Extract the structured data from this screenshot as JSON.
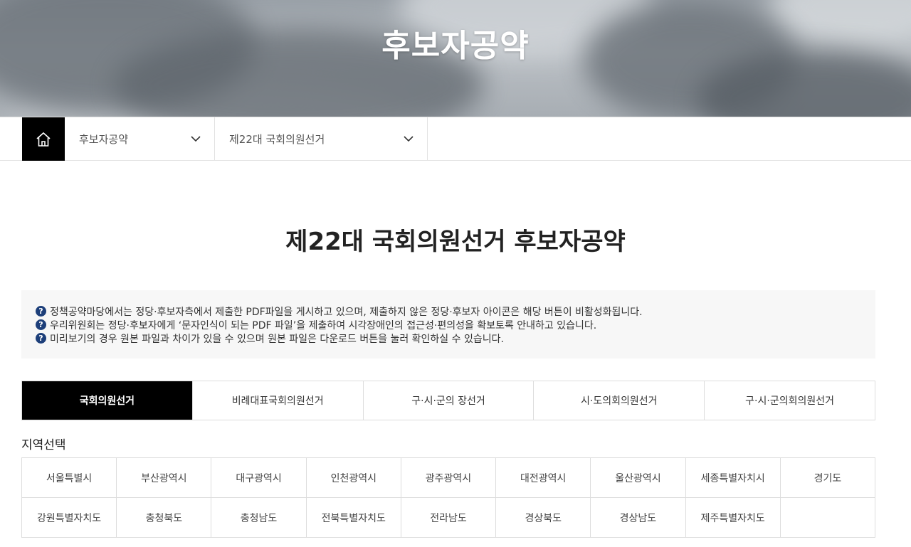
{
  "hero": {
    "title": "후보자공약"
  },
  "breadcrumb": {
    "home_icon": "home-icon",
    "menu1": "후보자공약",
    "menu2": "제22대 국회의원선거"
  },
  "page_title": "제22대 국회의원선거 후보자공약",
  "notices": [
    "정책공약마당에서는 정당·후보자측에서 제출한 PDF파일을 게시하고 있으며, 제출하지 않은 정당·후보자 아이콘은 해당 버튼이 비활성화됩니다.",
    "우리위원회는 정당·후보자에게 ‘문자인식이 되는 PDF 파일’을 제출하여 시각장애인의 접근성·편의성을 확보토록 안내하고 있습니다.",
    "미리보기의 경우 원본 파일과 차이가 있을 수 있으며 원본 파일은 다운로드 버튼을 눌러 확인하실 수 있습니다."
  ],
  "tabs": [
    "국회의원선거",
    "비례대표국회의원선거",
    "구·시·군의 장선거",
    "시·도의회의원선거",
    "구·시·군의회의원선거"
  ],
  "active_tab": 0,
  "region_label": "지역선택",
  "regions": [
    "서울특별시",
    "부산광역시",
    "대구광역시",
    "인천광역시",
    "광주광역시",
    "대전광역시",
    "울산광역시",
    "세종특별자치시",
    "경기도",
    "강원특별자치도",
    "충청북도",
    "충청남도",
    "전북특별자치도",
    "전라남도",
    "경상북도",
    "경상남도",
    "제주특별자치도",
    ""
  ],
  "colors": {
    "accent": "#000000",
    "notice_icon": "#1d3f7a",
    "info_bg": "#f7f7f7"
  }
}
